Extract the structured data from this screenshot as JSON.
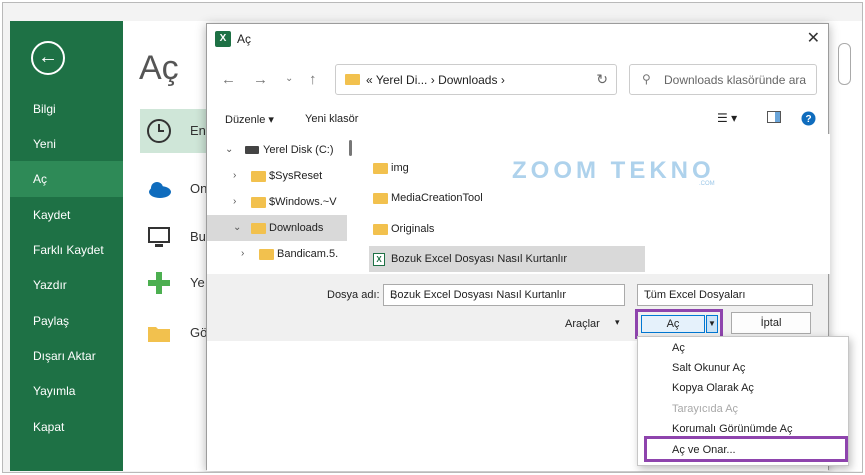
{
  "backstage": {
    "items": [
      {
        "label": "Bilgi"
      },
      {
        "label": "Yeni"
      },
      {
        "label": "Aç"
      },
      {
        "label": "Kaydet"
      },
      {
        "label": "Farklı Kaydet"
      },
      {
        "label": "Yazdır"
      },
      {
        "label": "Paylaş"
      },
      {
        "label": "Dışarı Aktar"
      },
      {
        "label": "Yayımla"
      },
      {
        "label": "Kapat"
      }
    ]
  },
  "main": {
    "title": "Aç",
    "options": [
      {
        "label": "En",
        "icon": "clock-icon"
      },
      {
        "label": "On",
        "icon": "onedrive-cloud-icon"
      },
      {
        "label": "Bu",
        "icon": "this-pc-icon"
      },
      {
        "label": "Ye",
        "icon": "add-place-icon"
      },
      {
        "label": "Gö",
        "icon": "browse-folder-icon"
      }
    ]
  },
  "dialog": {
    "title": "Aç",
    "breadcrumb": {
      "prefix": "«",
      "parts": [
        "Yerel Di...",
        "Downloads"
      ]
    },
    "search_placeholder": "Downloads klasöründe ara",
    "toolbar": {
      "organize": "Düzenle",
      "new_folder": "Yeni klasör"
    },
    "tree": [
      {
        "label": "Yerel Disk (C:)"
      },
      {
        "label": "$SysReset"
      },
      {
        "label": "$Windows.~V"
      },
      {
        "label": "Downloads"
      },
      {
        "label": "Bandicam.5."
      }
    ],
    "files": [
      {
        "label": "img"
      },
      {
        "label": "MediaCreationTool"
      },
      {
        "label": "Originals"
      },
      {
        "label": "Bozuk Excel Dosyası Nasıl Kurtanlır"
      }
    ],
    "watermark": "ZOOM TEKNO",
    "watermark_sub": ".COM",
    "filename_label": "Dosya adı:",
    "filename_value": "Bozuk Excel Dosyası Nasıl Kurtanlır",
    "filetype_value": "Tüm Excel Dosyaları",
    "tools_label": "Araçlar",
    "open_label": "Aç",
    "cancel_label": "İptal"
  },
  "open_menu": {
    "items": [
      {
        "label": "Aç"
      },
      {
        "label": "Salt Okunur Aç"
      },
      {
        "label": "Kopya Olarak Aç"
      },
      {
        "label": "Tarayıcıda Aç",
        "disabled": true
      },
      {
        "label": "Korumalı Görünümde Aç"
      },
      {
        "label": "Aç ve Onar..."
      }
    ]
  },
  "colors": {
    "excel_green": "#1e7145",
    "highlight_purple": "#8e44ad",
    "folder_yellow": "#f2c14e"
  }
}
